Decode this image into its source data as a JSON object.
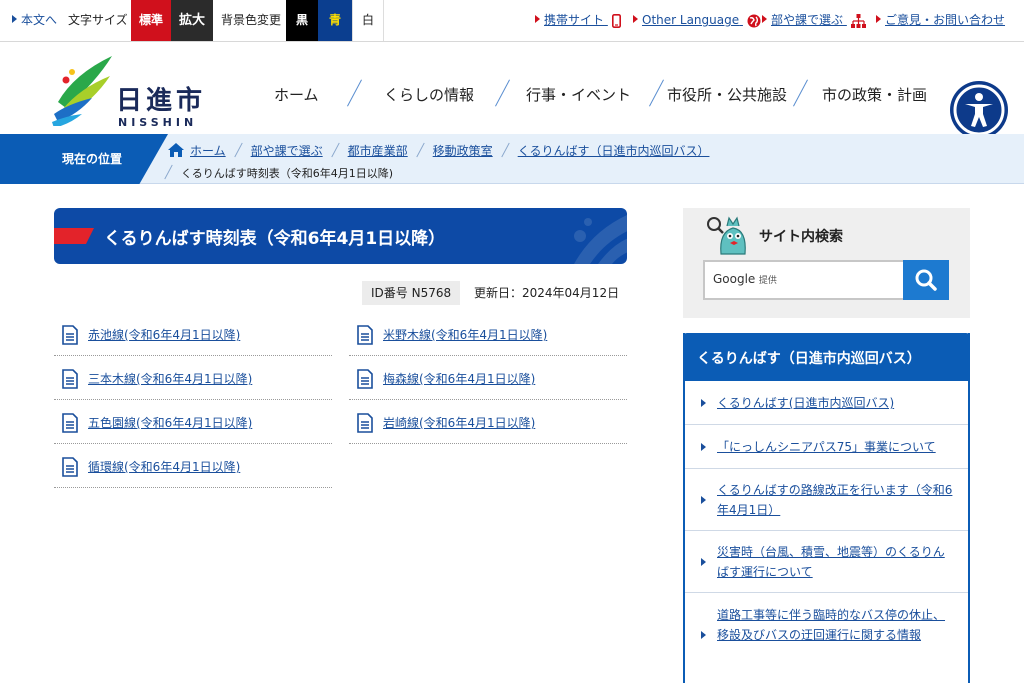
{
  "topbar": {
    "skip_link": "本文へ",
    "font_size_label": "文字サイズ",
    "font_standard": "標準",
    "font_large": "拡大",
    "bg_color_label": "背景色変更",
    "bg_black": "黒",
    "bg_blue": "青",
    "bg_white": "白",
    "mobile_site": "携帯サイト",
    "other_language": "Other Language",
    "by_department": "部や課で選ぶ",
    "contact": "ご意見・お問い合わせ"
  },
  "logo": {
    "kanji": "日進市",
    "roman": "NISSHIN"
  },
  "gnav": [
    "ホーム",
    "くらしの情報",
    "行事・イベント",
    "市役所・公共施設",
    "市の政策・計画"
  ],
  "breadcrumb": {
    "label": "現在の位置",
    "items": [
      "ホーム",
      "部や課で選ぶ",
      "都市産業部",
      "移動政策室",
      "くるりんばす（日進市内巡回バス）"
    ],
    "current": "くるりんばす時刻表（令和6年4月1日以降)"
  },
  "page": {
    "title": "くるりんばす時刻表（令和6年4月1日以降）",
    "id_number": "ID番号 N5768",
    "updated": "更新日：2024年04月12日"
  },
  "docs": [
    "赤池線(令和6年4月1日以降)",
    "米野木線(令和6年4月1日以降)",
    "三本木線(令和6年4月1日以降)",
    "梅森線(令和6年4月1日以降)",
    "五色園線(令和6年4月1日以降)",
    "岩崎線(令和6年4月1日以降)",
    "循環線(令和6年4月1日以降)"
  ],
  "search": {
    "title": "サイト内検索",
    "google": "Google",
    "provided": "提供"
  },
  "side_menu": {
    "title": "くるりんばす（日進市内巡回バス）",
    "items": [
      "くるりんばす(日進市内巡回バス)",
      "「にっしんシニアパス75」事業について",
      "くるりんばすの路線改正を行います（令和6年4月1日）",
      "災害時（台風、積雪、地震等）のくるりんばす運行について",
      "道路工事等に伴う臨時的なバス停の休止、移設及びバスの迂回運行に関する情報"
    ]
  },
  "colors": {
    "primary": "#0b5cb5",
    "accent_red": "#e3232a",
    "link": "#1a4f9c"
  }
}
